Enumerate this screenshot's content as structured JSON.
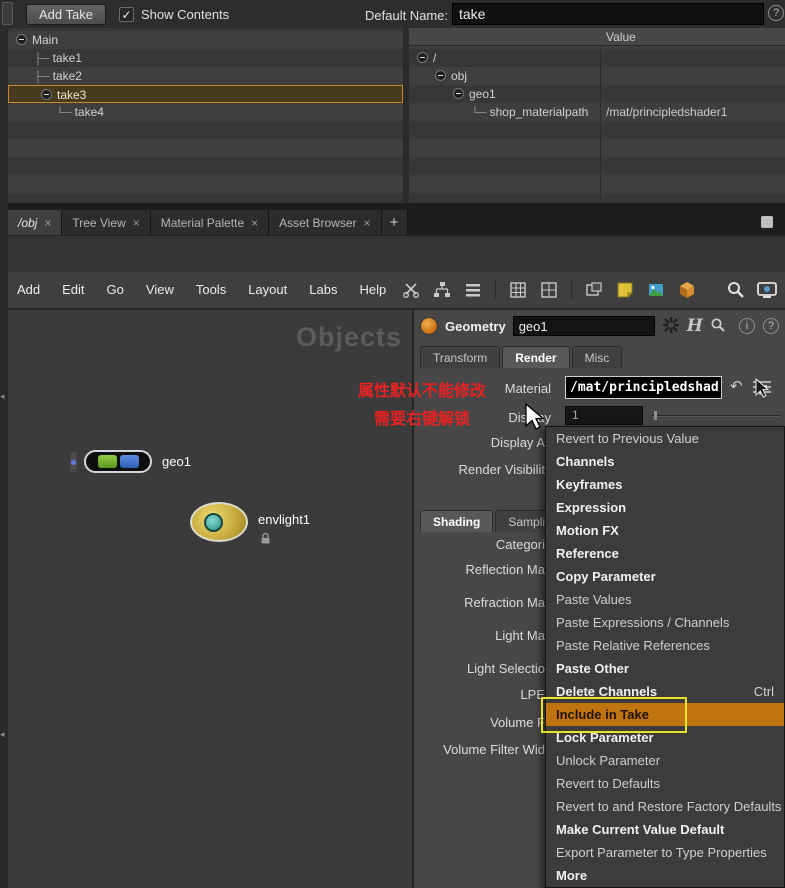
{
  "take_manager": {
    "add_take_button": "Add Take",
    "show_contents_label": "Show Contents",
    "default_name_label": "Default Name:",
    "default_name_value": "take",
    "takes_tree": [
      {
        "label": "Main"
      },
      {
        "label": "take1"
      },
      {
        "label": "take2"
      },
      {
        "label": "take3",
        "selected": true
      },
      {
        "label": "take4"
      }
    ],
    "contents_header": "Value",
    "contents_tree": [
      {
        "label": "/"
      },
      {
        "label": "obj"
      },
      {
        "label": "geo1"
      },
      {
        "label": "shop_materialpath",
        "value": "/mat/principledshader1"
      }
    ]
  },
  "tab_bar": {
    "tabs": [
      {
        "label": "/obj"
      },
      {
        "label": "Tree View"
      },
      {
        "label": "Material Palette"
      },
      {
        "label": "Asset Browser"
      }
    ],
    "new_tab": "+"
  },
  "nav_bar": {
    "path_value": "obj"
  },
  "menu_bar": {
    "items": [
      "Add",
      "Edit",
      "Go",
      "View",
      "Tools",
      "Layout",
      "Labs",
      "Help"
    ]
  },
  "network_editor": {
    "watermark": "Objects",
    "nodes": [
      {
        "label": "geo1"
      },
      {
        "label": "envlight1"
      }
    ],
    "annotation": {
      "line1": "属性默认不能修改",
      "line2": "需要右键解锁"
    }
  },
  "parameter_pane": {
    "node_type_label": "Geometry",
    "node_name": "geo1",
    "logo": "H",
    "tabs": [
      {
        "label": "Transform"
      },
      {
        "label": "Render"
      },
      {
        "label": "Misc"
      }
    ],
    "material_label": "Material",
    "material_value": "/mat/principledshad",
    "display_label": "Display",
    "display_value": "1",
    "sub_tabs": [
      {
        "label": "Shading"
      },
      {
        "label": "Sampling"
      }
    ],
    "left_labels": [
      "Display A",
      "Render Visibilit",
      "Categori",
      "Reflection Ma",
      "Refraction Ma",
      "Light Ma",
      "Light Selectio",
      "LPE",
      "Volume F",
      "Volume Filter Wid"
    ]
  },
  "context_menu": {
    "items": [
      {
        "label": "Revert to Previous Value"
      },
      {
        "label": "Channels",
        "bold": true
      },
      {
        "label": "Keyframes",
        "bold": true
      },
      {
        "label": "Expression",
        "bold": true
      },
      {
        "label": "Motion FX",
        "bold": true
      },
      {
        "label": "Reference",
        "bold": true
      },
      {
        "label": "Copy Parameter",
        "bold": true
      },
      {
        "label": "Paste Values"
      },
      {
        "label": "Paste Expressions / Channels"
      },
      {
        "label": "Paste Relative References"
      },
      {
        "label": "Paste Other",
        "bold": true
      },
      {
        "label": "Delete Channels",
        "bold": true,
        "shortcut": "Ctrl"
      },
      {
        "label": "Include in Take",
        "bold": true,
        "highlighted": true
      },
      {
        "label": "Lock Parameter",
        "bold": true
      },
      {
        "label": "Unlock Parameter"
      },
      {
        "label": "Revert to Defaults"
      },
      {
        "label": "Revert to and Restore Factory Defaults"
      },
      {
        "label": "Make Current Value Default",
        "bold": true
      },
      {
        "label": "Export Parameter to Type Properties"
      },
      {
        "label": "More",
        "bold": true
      }
    ]
  },
  "colors": {
    "take_selection_orange": "#c8872d",
    "menu_highlight_orange": "#bf7410",
    "annotation_red": "#e62222",
    "annotation_yellow": "#e6e22e"
  },
  "icons": {
    "close": "×",
    "check": "✓",
    "dropdown": "▼",
    "help": "?",
    "info": "i",
    "revert": "↶",
    "collapse_left": "◂"
  }
}
